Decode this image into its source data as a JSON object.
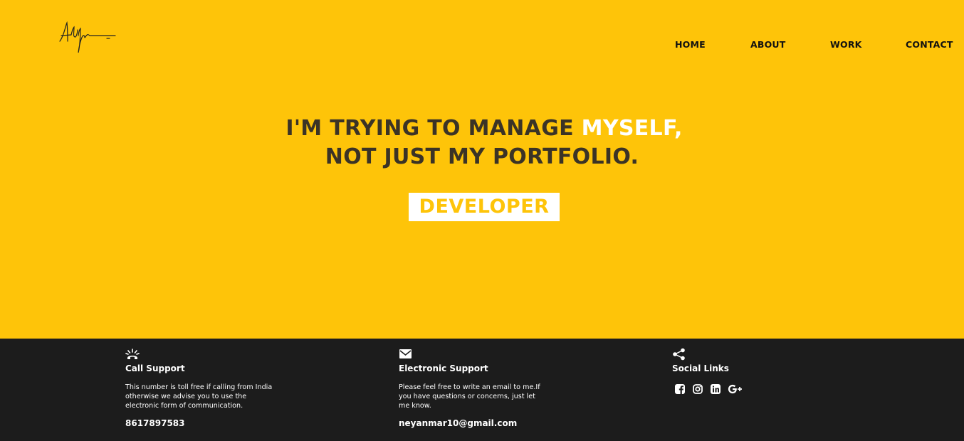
{
  "nav": {
    "home": "HOME",
    "about": "ABOUT",
    "work": "WORK",
    "contact": "CONTACT"
  },
  "hero": {
    "line1_prefix": "I'M TRYING TO MANAGE ",
    "line1_accent": "MYSELF,",
    "line2": "NOT JUST MY PORTFOLIO.",
    "role": "DEVELOPER"
  },
  "footer": {
    "call": {
      "icon": "phone-ringing-icon",
      "title": "Call Support",
      "text": "This number is toll free if calling from India otherwise we advise you to use the electronic form of communication.",
      "value": "8617897583"
    },
    "email": {
      "icon": "envelope-icon",
      "title": "Electronic Support",
      "text": "Please feel free to write an email to me.If you have questions or concerns, just let me know.",
      "value": "neyanmar10@gmail.com"
    },
    "social": {
      "icon": "share-icon",
      "title": "Social Links",
      "links": [
        "facebook-icon",
        "instagram-icon",
        "linkedin-icon",
        "google-plus-icon"
      ]
    }
  },
  "colors": {
    "accent": "#fec409",
    "footer_bg": "#1c1c1c",
    "headline": "#3b3326"
  }
}
